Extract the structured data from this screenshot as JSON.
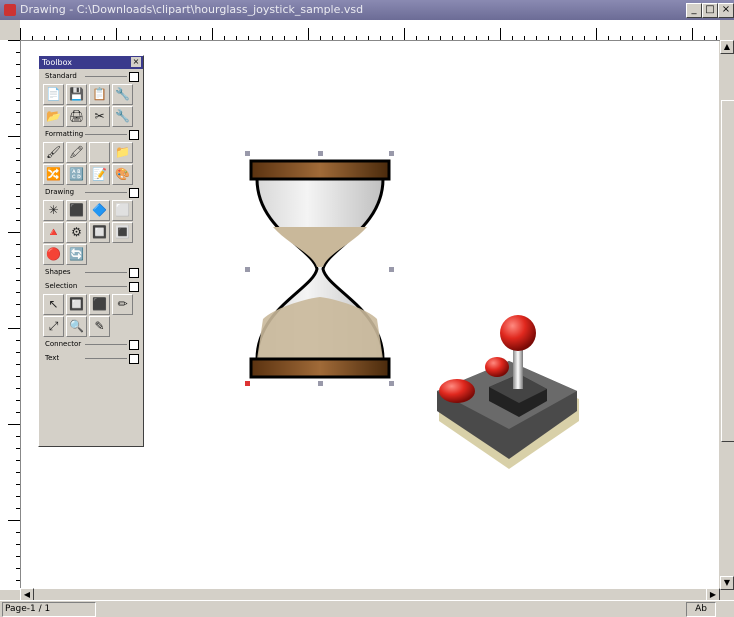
{
  "window": {
    "title": "Drawing - C:\\Downloads\\clipart\\hourglass_joystick_sample.vsd",
    "minimize_label": "_",
    "restore_label": "□",
    "close_label": "×"
  },
  "palette": {
    "title": "Toolbox",
    "close_label": "×",
    "sections": [
      {
        "label": "Standard",
        "tools": [
          [
            "📄",
            "💾",
            "📋",
            "🔧"
          ],
          [
            "📂",
            "🖨",
            "✂",
            "🔧"
          ]
        ]
      },
      {
        "label": "Formatting",
        "tools": [
          [
            "🖌",
            "🖍",
            "",
            "📁"
          ],
          [
            "🔀",
            "🔠",
            "📝",
            "🎨"
          ]
        ]
      },
      {
        "label": "Drawing",
        "tools": [
          [
            "✳",
            "⬛",
            "🔷",
            "⬜"
          ],
          [
            "🔺",
            "⚙",
            "🔲",
            "🔳"
          ],
          [
            "🔴",
            "🔄"
          ]
        ]
      },
      {
        "label": "Shapes",
        "tools": []
      },
      {
        "label": "Selection",
        "tools": [
          [
            "↖",
            "🔲",
            "⬛",
            "✏"
          ],
          [
            "⤢",
            "🔍",
            "✎"
          ]
        ]
      },
      {
        "label": "Connector",
        "tools": []
      },
      {
        "label": "Text",
        "tools": []
      }
    ]
  },
  "statusbar": {
    "left_text": "Page-1 / 1",
    "right_text": "Ab"
  },
  "colors": {
    "titlebar": "#7b7ba6",
    "hourglass_frame": "#7a4a1c",
    "sand": "#c9b89a",
    "joystick_ball": "#e0281e",
    "joystick_base": "#3a3a3a"
  }
}
